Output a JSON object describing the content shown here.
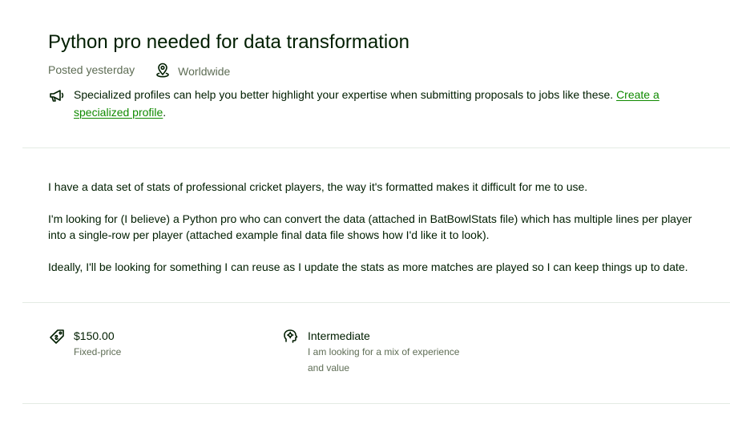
{
  "job": {
    "title": "Python pro needed for data transformation",
    "posted": "Posted yesterday",
    "location": "Worldwide",
    "tip": {
      "text": "Specialized profiles can help you better highlight your expertise when submitting proposals to jobs like these.",
      "link_label": "Create a specialized profile",
      "trailing": "."
    },
    "description": [
      "I have a data set of stats of professional cricket players, the way it's formatted makes it difficult for me to use.",
      "I'm looking for (I believe) a Python pro who can convert the data (attached in BatBowlStats file) which has multiple lines per player into a single-row per player (attached example final data file shows how I'd like it to look).",
      "Ideally, I'll be looking for something I can reuse as I update the stats as more matches are played so I can keep things up to date."
    ],
    "budget": {
      "amount": "$150.00",
      "type": "Fixed-price"
    },
    "experience": {
      "level": "Intermediate",
      "note": "I am looking for a mix of experience and value"
    }
  },
  "icons": {
    "location": "location-pin-icon",
    "tip": "megaphone-icon",
    "budget": "price-tag-icon",
    "experience": "gear-brain-icon"
  },
  "colors": {
    "text": "#001e00",
    "muted": "#5e6d55",
    "link": "#108a00",
    "divider": "#e4ebe4"
  }
}
